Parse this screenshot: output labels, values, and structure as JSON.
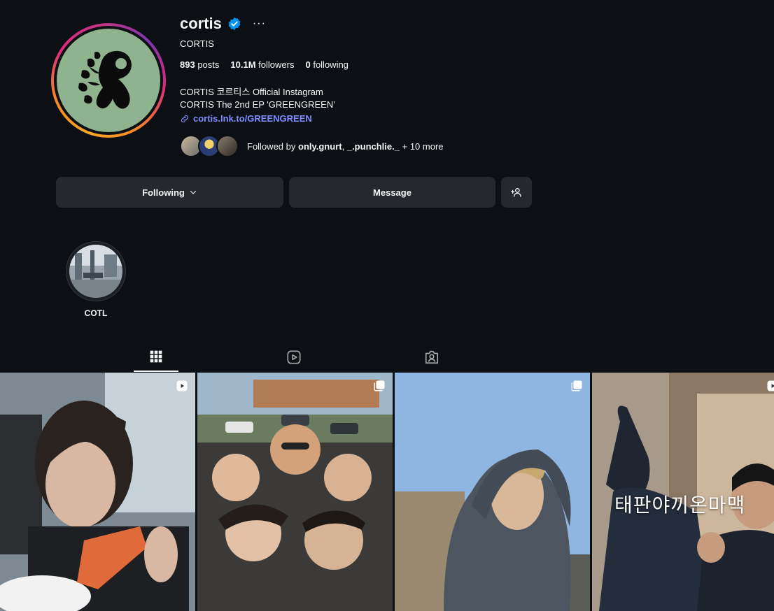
{
  "profile": {
    "username": "cortis",
    "full_name": "CORTIS",
    "more_label": "···",
    "posts_count": "893",
    "posts_label": "posts",
    "followers_count": "10.1M",
    "followers_label": "followers",
    "following_count": "0",
    "following_label": "following",
    "bio_line1": "CORTIS 코르티스 Official Instagram",
    "bio_line2": "CORTIS The 2nd EP 'GREENGREEN'",
    "link": "cortis.lnk.to/GREENGREEN",
    "followed_by_prefix": "Followed by",
    "followed_by_user1": "only.gnurt",
    "followed_by_sep": ",",
    "followed_by_user2": "_.punchlie._",
    "followed_by_more": "+ 10 more"
  },
  "actions": {
    "following_label": "Following",
    "message_label": "Message"
  },
  "highlights": [
    {
      "label": "COTL"
    }
  ],
  "tabs": [
    {
      "icon": "grid-icon",
      "active": true
    },
    {
      "icon": "reels-icon",
      "active": false
    },
    {
      "icon": "tagged-icon",
      "active": false
    }
  ],
  "posts": [
    {
      "type": "reel",
      "badge_icon": "reel-icon"
    },
    {
      "type": "carousel",
      "badge_icon": "carousel-icon"
    },
    {
      "type": "carousel",
      "badge_icon": "carousel-icon"
    },
    {
      "type": "reel",
      "badge_icon": "reel-icon",
      "overlay_text": "태판야끼온마맥"
    }
  ],
  "colors": {
    "background": "#0c0f14",
    "button": "#25292e",
    "link": "#7f8fff",
    "verified": "#0095f6",
    "avatar_bg": "#8fb28f"
  }
}
